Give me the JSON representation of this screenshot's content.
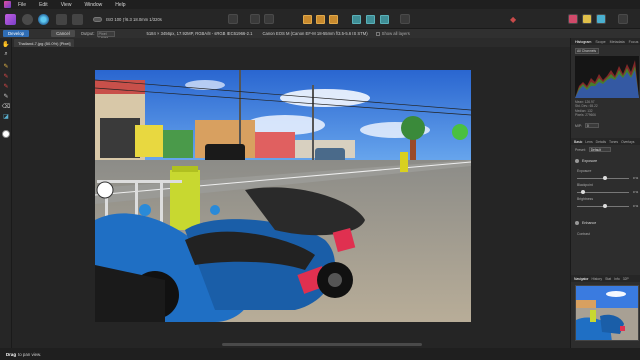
{
  "menu": [
    "File",
    "Edit",
    "View",
    "Window",
    "Help"
  ],
  "toolbar": {
    "camera_info": "ISO 100 ƒ/6.3 18.0mm 1/320s"
  },
  "context": {
    "develop": "Develop",
    "cancel": "Cancel",
    "output_label": "Output:",
    "output_value": "Pixel Layer",
    "image_info": "5184 × 3456px, 17.92MP, RGBA/8 - sRGB IEC61966-2.1",
    "camera": "Canon EOS M (Canon EF-M 18-55mm f/3.5-5.6 IS STM)",
    "show_layers": "Show all layers"
  },
  "document": {
    "tab": "Thailand-7.jpg (50.0%) [Pixel]"
  },
  "status": {
    "bold": "Drag",
    "text": "to pan view."
  },
  "panel": {
    "tabs": [
      "Histogram",
      "Scope",
      "Metadata",
      "Focus"
    ],
    "channels": "All Channels",
    "stats": [
      "Mean: 126.97",
      "Std. Dev.: 65.22",
      "Median: 132",
      "Pixels: 279606"
    ],
    "mip_label": "MIP:",
    "mip_value": "0",
    "subtabs": [
      "Basic",
      "Lens",
      "Details",
      "Tones",
      "Overlays"
    ],
    "preset_label": "Preset:",
    "preset_value": "Default",
    "exposure": "Exposure",
    "exposure_label": "Exposure",
    "blackpoint_label": "Blackpoint",
    "brightness_label": "Brightness",
    "enhance": "Enhance",
    "contrast_label": "Contrast",
    "values": [
      "0 %",
      "0 %",
      "0 %"
    ],
    "nav_tabs": [
      "Navigator",
      "History",
      "Stat",
      "Info",
      "32P"
    ]
  },
  "colors": {
    "accent": "#2f6db5",
    "sky": "#3a7be0",
    "scooter": "#1f6fc4"
  }
}
